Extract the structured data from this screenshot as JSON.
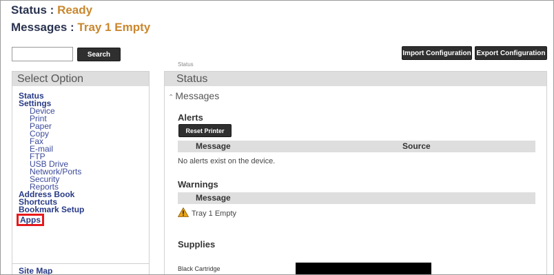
{
  "header": {
    "status_label": "Status : ",
    "status_value": "Ready",
    "messages_label": "Messages : ",
    "messages_value": "Tray 1 Empty"
  },
  "search": {
    "button_label": "Search",
    "input_value": ""
  },
  "top_buttons": {
    "import": "Import Configuration",
    "export": "Export Configuration"
  },
  "breadcrumb": "Status",
  "sidebar": {
    "title": "Select Option",
    "status": "Status",
    "settings": "Settings",
    "settings_items": [
      "Device",
      "Print",
      "Paper",
      "Copy",
      "Fax",
      "E-mail",
      "FTP",
      "USB Drive",
      "Network/Ports",
      "Security",
      "Reports"
    ],
    "address_book": "Address Book",
    "shortcuts": "Shortcuts",
    "bookmark_setup": "Bookmark Setup",
    "apps": "Apps",
    "site_map": "Site Map"
  },
  "panel": {
    "title": "Status",
    "messages_toggle": "Messages",
    "alerts": {
      "heading": "Alerts",
      "reset_button": "Reset Printer",
      "col_message": "Message",
      "col_source": "Source",
      "empty_text": "No alerts exist on the device."
    },
    "warnings": {
      "heading": "Warnings",
      "col_message": "Message",
      "items": [
        "Tray 1 Empty"
      ]
    },
    "supplies": {
      "heading": "Supplies",
      "items": [
        "Black Cartridge"
      ]
    }
  },
  "colors": {
    "status_value": "#c9872e",
    "nav_link": "#273a86",
    "highlight_box": "#e8191c",
    "warning_icon": "#e8a317"
  },
  "icons": {
    "warning": "warning-triangle-icon",
    "collapse": "double-chevron-up-icon"
  }
}
